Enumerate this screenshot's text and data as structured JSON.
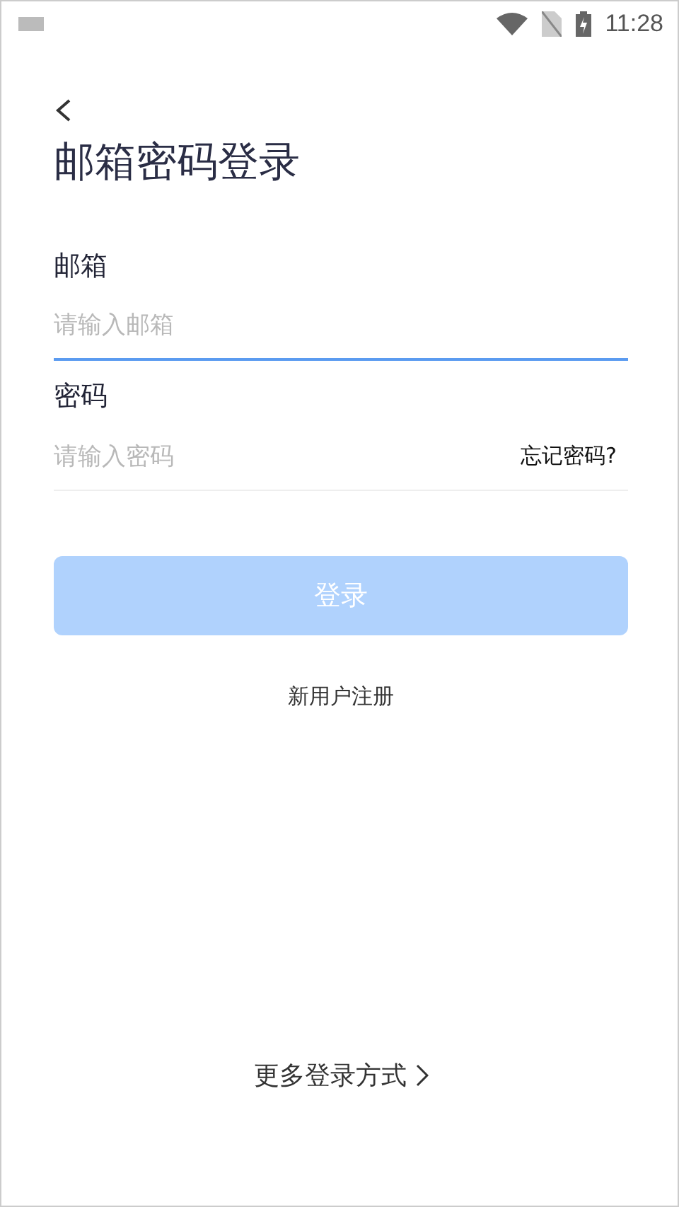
{
  "status_bar": {
    "time": "11:28"
  },
  "title": "邮箱密码登录",
  "fields": [
    {
      "label": "邮箱",
      "placeholder": "请输入邮箱",
      "focused": true
    },
    {
      "label": "密码",
      "placeholder": "请输入密码",
      "focused": false,
      "action": "忘记密码?"
    }
  ],
  "login_button": {
    "label": "登录",
    "disabled": true
  },
  "register_link": "新用户注册",
  "more_options": "更多登录方式"
}
